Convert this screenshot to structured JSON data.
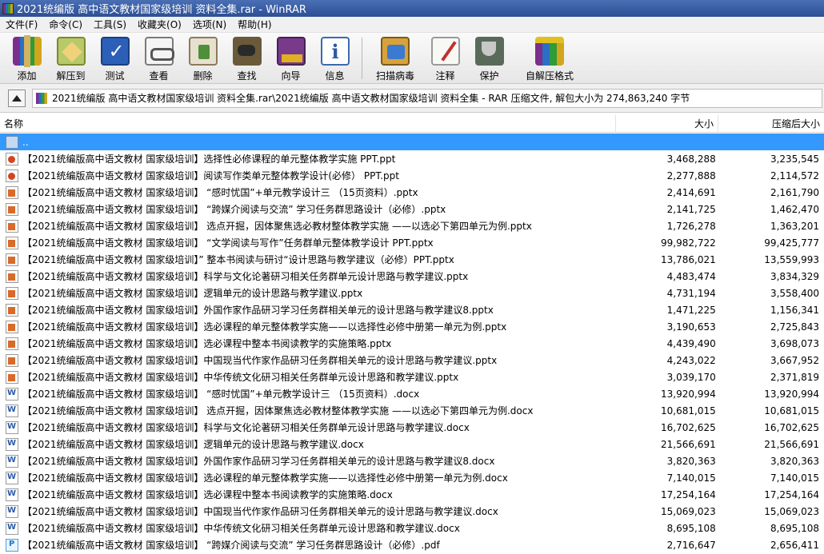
{
  "window": {
    "title": "2021统编版 高中语文教材国家级培训 资料全集.rar - WinRAR"
  },
  "menu": [
    {
      "id": "file",
      "label": "文件(F)"
    },
    {
      "id": "commands",
      "label": "命令(C)"
    },
    {
      "id": "tools",
      "label": "工具(S)"
    },
    {
      "id": "favorites",
      "label": "收藏夹(O)"
    },
    {
      "id": "options",
      "label": "选项(N)"
    },
    {
      "id": "help",
      "label": "帮助(H)"
    }
  ],
  "toolbar": [
    {
      "id": "add",
      "label": "添加",
      "icon": "add-archive-icon"
    },
    {
      "id": "extract",
      "label": "解压到",
      "icon": "extract-icon"
    },
    {
      "id": "test",
      "label": "测试",
      "icon": "test-icon"
    },
    {
      "id": "view",
      "label": "查看",
      "icon": "view-icon"
    },
    {
      "id": "delete",
      "label": "删除",
      "icon": "delete-icon"
    },
    {
      "id": "find",
      "label": "查找",
      "icon": "find-icon"
    },
    {
      "id": "wizard",
      "label": "向导",
      "icon": "wizard-icon"
    },
    {
      "id": "info",
      "label": "信息",
      "icon": "info-icon"
    },
    {
      "id": "virusscan",
      "label": "扫描病毒",
      "icon": "virus-scan-icon"
    },
    {
      "id": "comment",
      "label": "注释",
      "icon": "comment-icon"
    },
    {
      "id": "protect",
      "label": "保护",
      "icon": "protect-icon"
    },
    {
      "id": "sfx",
      "label": "自解压格式",
      "icon": "sfx-icon"
    }
  ],
  "address": {
    "text": "2021统编版 高中语文教材国家级培训 资料全集.rar\\2021统编版 高中语文教材国家级培训 资料全集 - RAR 压缩文件, 解包大小为 274,863,240 字节"
  },
  "columns": {
    "name": "名称",
    "size": "大小",
    "packed": "压缩后大小"
  },
  "up_row": {
    "name": ".."
  },
  "files": [
    {
      "type": "ppt",
      "name": "【2021统编版高中语文教材 国家级培训】选择性必修课程的单元整体教学实施  PPT.ppt",
      "size": "3,468,288",
      "packed": "3,235,545"
    },
    {
      "type": "ppt",
      "name": "【2021统编版高中语文教材 国家级培训】阅读写作类单元整体教学设计(必修）  PPT.ppt",
      "size": "2,277,888",
      "packed": "2,114,572"
    },
    {
      "type": "pptx",
      "name": "【2021统编版高中语文教材 国家级培训】 “感时忧国”+单元教学设计三 （15页资料）.pptx",
      "size": "2,414,691",
      "packed": "2,161,790"
    },
    {
      "type": "pptx",
      "name": "【2021统编版高中语文教材 国家级培训】 “跨媒介阅读与交流” 学习任务群思路设计（必修）.pptx",
      "size": "2,141,725",
      "packed": "1,462,470"
    },
    {
      "type": "pptx",
      "name": "【2021统编版高中语文教材 国家级培训】 选点开掘，因体聚焦选必教材整体教学实施 ——以选必下第四单元为例.pptx",
      "size": "1,726,278",
      "packed": "1,363,201"
    },
    {
      "type": "pptx",
      "name": "【2021统编版高中语文教材 国家级培训】 “文学阅读与写作”任务群单元整体教学设计 PPT.pptx",
      "size": "99,982,722",
      "packed": "99,425,777"
    },
    {
      "type": "pptx",
      "name": "【2021统编版高中语文教材 国家级培训】” 整本书阅读与研讨“设计思路与教学建议（必修）PPT.pptx",
      "size": "13,786,021",
      "packed": "13,559,993"
    },
    {
      "type": "pptx",
      "name": "【2021统编版高中语文教材 国家级培训】科学与文化论著研习相关任务群单元设计思路与教学建议.pptx",
      "size": "4,483,474",
      "packed": "3,834,329"
    },
    {
      "type": "pptx",
      "name": "【2021统编版高中语文教材 国家级培训】逻辑单元的设计思路与教学建议.pptx",
      "size": "4,731,194",
      "packed": "3,558,400"
    },
    {
      "type": "pptx",
      "name": "【2021统编版高中语文教材 国家级培训】外国作家作品研习学习任务群相关单元的设计思路与教学建议8.pptx",
      "size": "1,471,225",
      "packed": "1,156,341"
    },
    {
      "type": "pptx",
      "name": "【2021统编版高中语文教材 国家级培训】选必课程的单元整体教学实施——以选择性必修中册第一单元为例.pptx",
      "size": "3,190,653",
      "packed": "2,725,843"
    },
    {
      "type": "pptx",
      "name": "【2021统编版高中语文教材 国家级培训】选必课程中整本书阅读教学的实施策略.pptx",
      "size": "4,439,490",
      "packed": "3,698,073"
    },
    {
      "type": "pptx",
      "name": "【2021统编版高中语文教材 国家级培训】中国现当代作家作品研习任务群相关单元的设计思路与教学建议.pptx",
      "size": "4,243,022",
      "packed": "3,667,952"
    },
    {
      "type": "pptx",
      "name": "【2021统编版高中语文教材 国家级培训】中华传统文化研习相关任务群单元设计思路和教学建议.pptx",
      "size": "3,039,170",
      "packed": "2,371,819"
    },
    {
      "type": "docx",
      "name": "【2021统编版高中语文教材 国家级培训】 “感时忧国”+单元教学设计三 （15页资料）.docx",
      "size": "13,920,994",
      "packed": "13,920,994"
    },
    {
      "type": "docx",
      "name": "【2021统编版高中语文教材 国家级培训】 选点开掘，因体聚焦选必教材整体教学实施 ——以选必下第四单元为例.docx",
      "size": "10,681,015",
      "packed": "10,681,015"
    },
    {
      "type": "docx",
      "name": "【2021统编版高中语文教材 国家级培训】科学与文化论著研习相关任务群单元设计思路与教学建议.docx",
      "size": "16,702,625",
      "packed": "16,702,625"
    },
    {
      "type": "docx",
      "name": "【2021统编版高中语文教材 国家级培训】逻辑单元的设计思路与教学建议.docx",
      "size": "21,566,691",
      "packed": "21,566,691"
    },
    {
      "type": "docx",
      "name": "【2021统编版高中语文教材 国家级培训】外国作家作品研习学习任务群相关单元的设计思路与教学建议8.docx",
      "size": "3,820,363",
      "packed": "3,820,363"
    },
    {
      "type": "docx",
      "name": "【2021统编版高中语文教材 国家级培训】选必课程的单元整体教学实施——以选择性必修中册第一单元为例.docx",
      "size": "7,140,015",
      "packed": "7,140,015"
    },
    {
      "type": "docx",
      "name": "【2021统编版高中语文教材 国家级培训】选必课程中整本书阅读教学的实施策略.docx",
      "size": "17,254,164",
      "packed": "17,254,164"
    },
    {
      "type": "docx",
      "name": "【2021统编版高中语文教材 国家级培训】中国现当代作家作品研习任务群相关单元的设计思路与教学建议.docx",
      "size": "15,069,023",
      "packed": "15,069,023"
    },
    {
      "type": "docx",
      "name": "【2021统编版高中语文教材 国家级培训】中华传统文化研习相关任务群单元设计思路和教学建议.docx",
      "size": "8,695,108",
      "packed": "8,695,108"
    },
    {
      "type": "pdf",
      "name": "【2021统编版高中语文教材 国家级培训】 “跨媒介阅读与交流” 学习任务群思路设计（必修）.pdf",
      "size": "2,716,647",
      "packed": "2,656,411"
    }
  ]
}
